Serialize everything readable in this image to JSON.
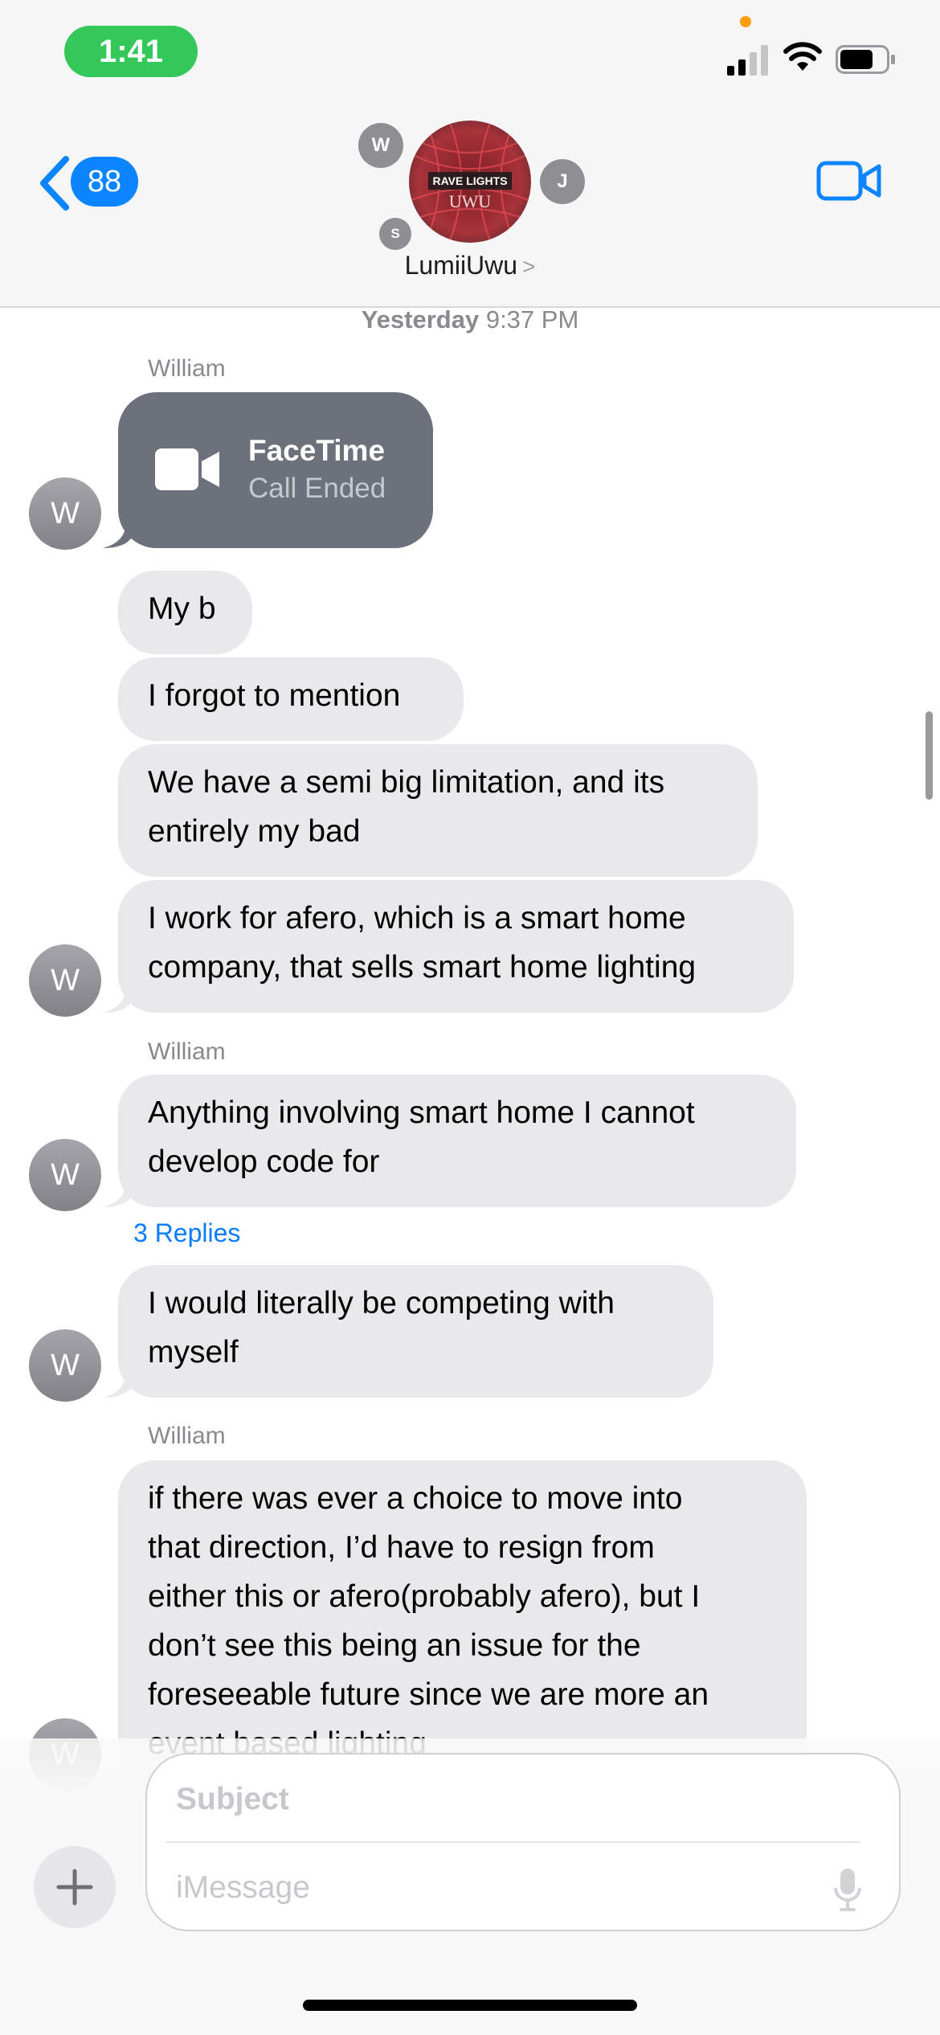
{
  "status_bar": {
    "time": "1:41"
  },
  "header": {
    "back_count": "88",
    "group_name": "LumiiUwu",
    "group_avatar_text_1": "RAVE LIGHTS",
    "group_avatar_text_2": "UWU",
    "member_initials": [
      "W",
      "J",
      "S"
    ],
    "name_chevron": ">"
  },
  "conversation": {
    "timestamp_day": "Yesterday",
    "timestamp_time": "9:37 PM",
    "sender": "William",
    "avatar_initial": "W",
    "facetime": {
      "title": "FaceTime",
      "subtitle": "Call Ended"
    },
    "messages": [
      {
        "lines": [
          "My b"
        ]
      },
      {
        "lines": [
          "I forgot to mention"
        ]
      },
      {
        "lines": [
          "We have a semi big limitation, and its",
          "entirely my bad"
        ]
      },
      {
        "lines": [
          "I work for afero, which is a smart home",
          "company, that sells smart home lighting"
        ]
      },
      {
        "lines": [
          "Anything involving smart home I cannot",
          "develop code for"
        ]
      },
      {
        "lines": [
          "I would literally be competing with",
          "myself"
        ]
      },
      {
        "lines": [
          "if there was ever a choice to move into",
          "that direction, I’d have to resign from",
          "either this or afero(probably afero), but I",
          "don’t see this being an issue for the",
          "foreseeable future since we are more an",
          "event based lighting"
        ]
      }
    ],
    "replies_label": "3 Replies"
  },
  "composer": {
    "subject_placeholder": "Subject",
    "message_placeholder": "iMessage"
  },
  "colors": {
    "accent": "#0a84ff",
    "time_pill": "#34c759",
    "bubble_gray": "#e9e9eb",
    "facetime_bubble": "#6d717b"
  },
  "icons": [
    "signal-icon",
    "wifi-icon",
    "battery-icon",
    "back-chevron-icon",
    "video-call-icon",
    "facetime-video-icon",
    "plus-icon",
    "microphone-icon"
  ]
}
